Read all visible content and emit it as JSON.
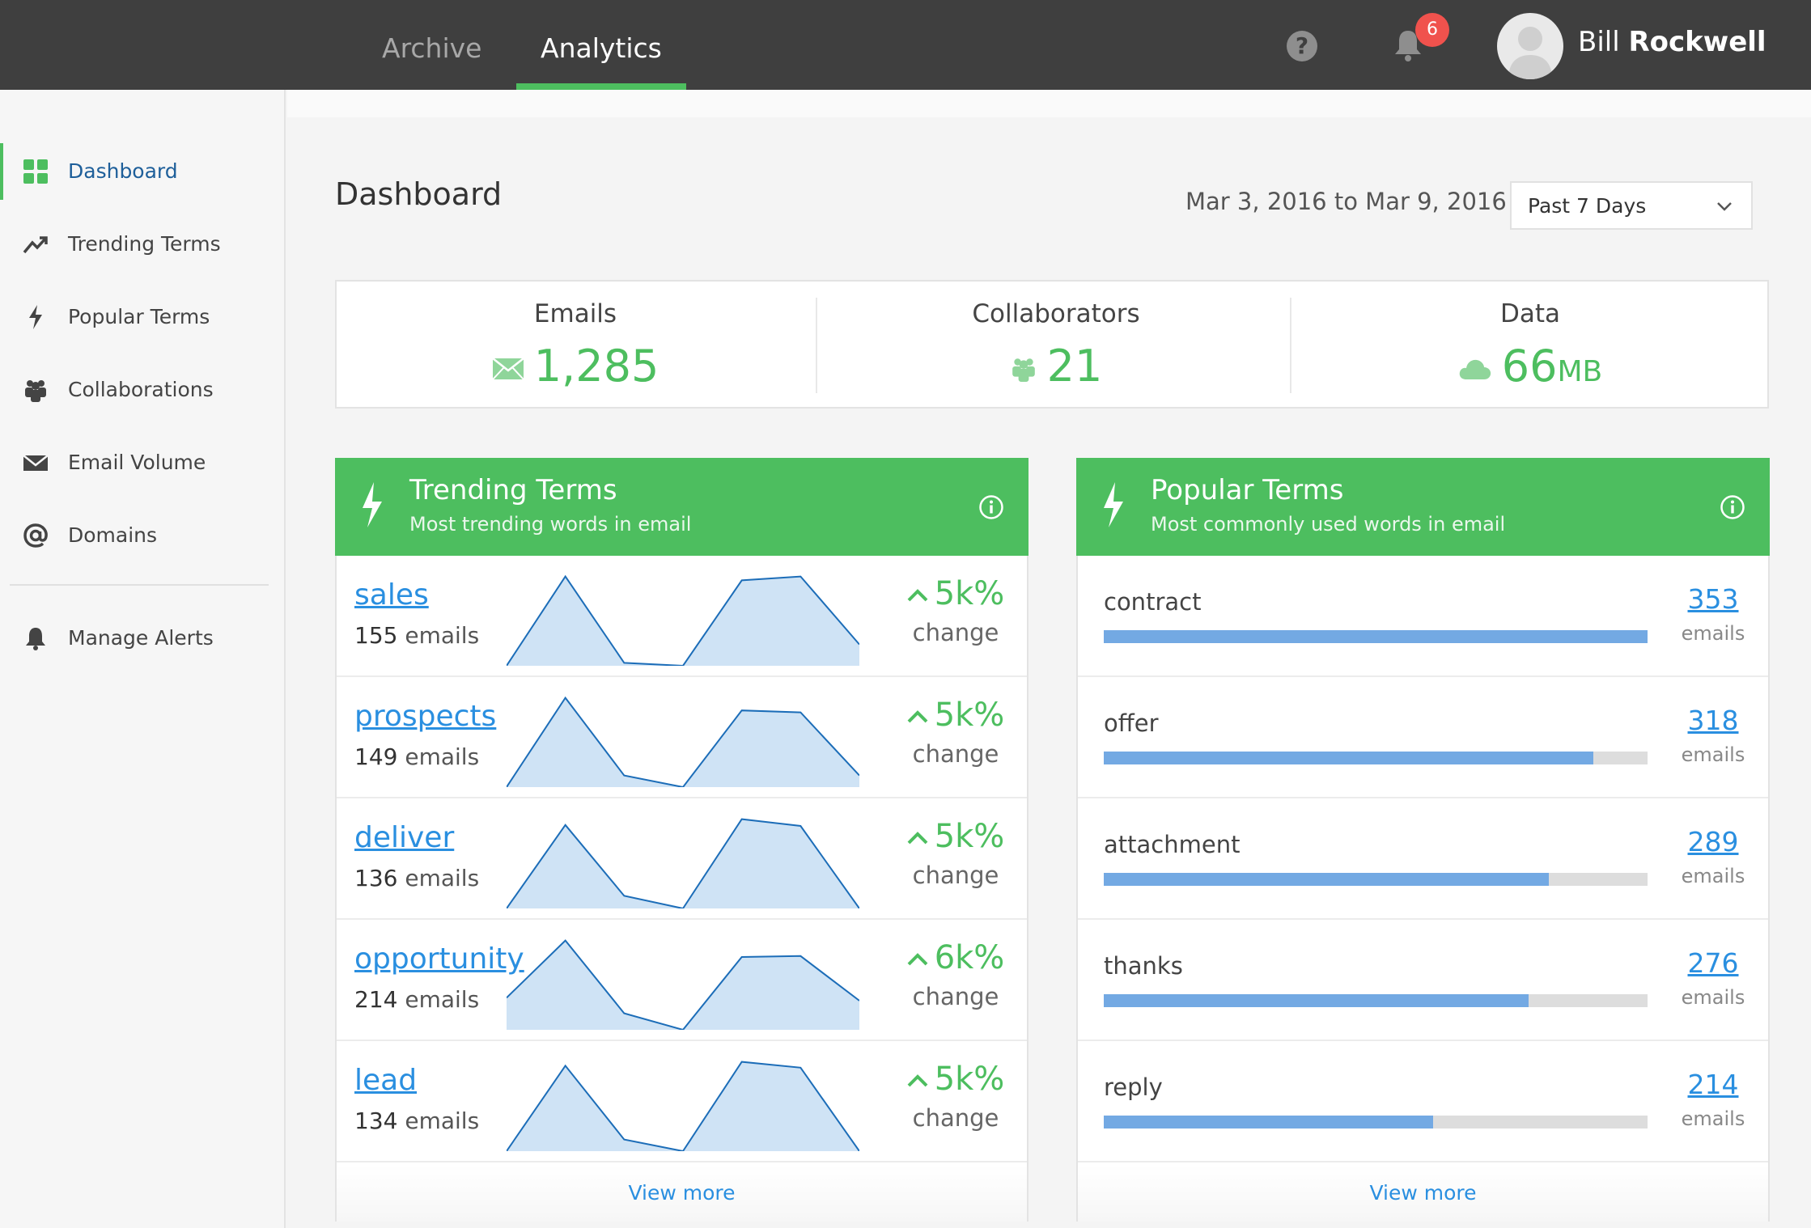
{
  "topbar": {
    "tabs": [
      {
        "label": "Archive",
        "active": false
      },
      {
        "label": "Analytics",
        "active": true
      }
    ],
    "notifications_count": "6",
    "user": {
      "first_name": "Bill",
      "last_name": "Rockwell"
    },
    "icons": {
      "help": "help-circle-icon",
      "bell": "bell-icon",
      "avatar": "user-avatar-icon"
    }
  },
  "sidebar": {
    "items": [
      {
        "label": "Dashboard",
        "icon": "grid-icon",
        "active": true
      },
      {
        "label": "Trending Terms",
        "icon": "trending-up-icon",
        "active": false
      },
      {
        "label": "Popular Terms",
        "icon": "lightning-icon",
        "active": false
      },
      {
        "label": "Collaborations",
        "icon": "people-icon",
        "active": false
      },
      {
        "label": "Email Volume",
        "icon": "envelope-icon",
        "active": false
      },
      {
        "label": "Domains",
        "icon": "at-sign-icon",
        "active": false
      }
    ],
    "footer_items": [
      {
        "label": "Manage Alerts",
        "icon": "bell-icon"
      }
    ]
  },
  "main": {
    "title": "Dashboard",
    "date_range": "Mar 3, 2016 to Mar 9, 2016",
    "range_select": "Past 7 Days",
    "stats": [
      {
        "label": "Emails",
        "value": "1,285",
        "unit": "",
        "icon": "envelope-icon"
      },
      {
        "label": "Collaborators",
        "value": "21",
        "unit": "",
        "icon": "people-icon"
      },
      {
        "label": "Data",
        "value": "66",
        "unit": "MB",
        "icon": "cloud-icon"
      }
    ]
  },
  "trending": {
    "title": "Trending Terms",
    "subtitle": "Most trending words in email",
    "view_more": "View more",
    "rows": [
      {
        "term": "sales",
        "count": "155",
        "count_unit": "emails",
        "change": "5k%",
        "change_label": "change",
        "spark": [
          0.0,
          0.92,
          0.03,
          0.0,
          0.88,
          0.92,
          0.22
        ]
      },
      {
        "term": "prospects",
        "count": "149",
        "count_unit": "emails",
        "change": "5k%",
        "change_label": "change",
        "spark": [
          0.0,
          0.92,
          0.12,
          0.0,
          0.79,
          0.77,
          0.12
        ]
      },
      {
        "term": "deliver",
        "count": "136",
        "count_unit": "emails",
        "change": "5k%",
        "change_label": "change",
        "spark": [
          0.0,
          0.86,
          0.13,
          0.0,
          0.92,
          0.85,
          0.0
        ]
      },
      {
        "term": "opportunity",
        "count": "214",
        "count_unit": "emails",
        "change": "6k%",
        "change_label": "change",
        "spark": [
          0.33,
          0.92,
          0.17,
          0.0,
          0.75,
          0.76,
          0.3
        ]
      },
      {
        "term": "lead",
        "count": "134",
        "count_unit": "emails",
        "change": "5k%",
        "change_label": "change",
        "spark": [
          0.0,
          0.88,
          0.12,
          0.0,
          0.92,
          0.86,
          0.0
        ]
      }
    ]
  },
  "popular": {
    "title": "Popular Terms",
    "subtitle": "Most commonly used words in email",
    "view_more": "View more",
    "max": 353,
    "rows": [
      {
        "term": "contract",
        "count": "353",
        "count_unit": "emails",
        "value": 353
      },
      {
        "term": "offer",
        "count": "318",
        "count_unit": "emails",
        "value": 318
      },
      {
        "term": "attachment",
        "count": "289",
        "count_unit": "emails",
        "value": 289
      },
      {
        "term": "thanks",
        "count": "276",
        "count_unit": "emails",
        "value": 276
      },
      {
        "term": "reply",
        "count": "214",
        "count_unit": "emails",
        "value": 214
      }
    ]
  },
  "colors": {
    "accent_green": "#4dbe5f",
    "topbar": "#3f3f3f",
    "link_blue": "#2a8fe0",
    "bar_blue": "#73a9e3",
    "badge_red": "#f0524d"
  }
}
